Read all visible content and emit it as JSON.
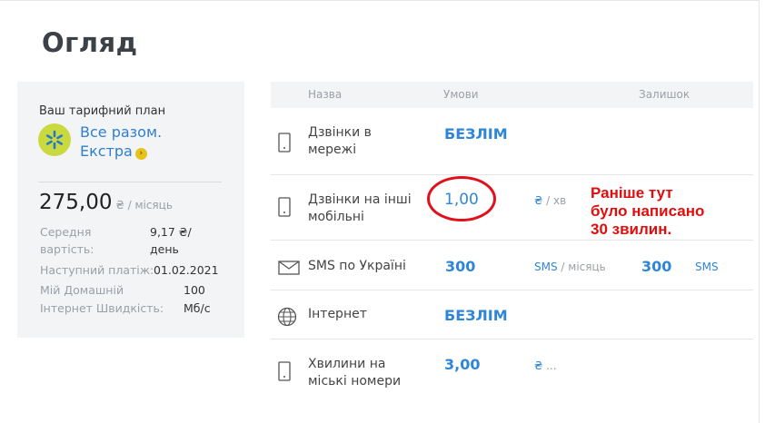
{
  "page": {
    "title": "Огляд"
  },
  "tariff": {
    "caption": "Ваш тарифний план",
    "name_line1": "Все разом.",
    "name_line2": "Екстра",
    "go_icon": "›",
    "price": "275,00",
    "price_unit": "₴ / місяць",
    "stats": [
      {
        "label1": "Середня",
        "label2": "вартість:",
        "value1": "9,17 ₴/",
        "value2": "день"
      },
      {
        "label": "Наступний платіж:",
        "value": "01.02.2021"
      },
      {
        "label": "Мій Домашній",
        "value": "100"
      },
      {
        "label": "Інтернет Швидкість:",
        "value": "Мб/с"
      }
    ],
    "logo_color": "#c9da3f"
  },
  "table": {
    "headers": {
      "name": "Назва",
      "terms": "Умови",
      "remaining": "Залишок"
    },
    "rows": [
      {
        "icon": "phone-icon",
        "name_line1": "Дзвінки в",
        "name_line2": "мережі",
        "value": "БЕЗЛІМ"
      },
      {
        "icon": "phone-icon",
        "name_line1": "Дзвінки на інші",
        "name_line2": "мобільні",
        "value": "1,00",
        "unit_main": "₴",
        "unit_sub": " / хв"
      },
      {
        "icon": "envelope-icon",
        "name": "SMS по Україні",
        "value": "300",
        "unit_main": "SMS",
        "unit_sub": " / місяць",
        "remaining": "300",
        "remaining_unit": "SMS"
      },
      {
        "icon": "globe-icon",
        "name": "Інтернет",
        "value": "БЕЗЛІМ"
      },
      {
        "icon": "phone-icon",
        "name_line1": "Хвилини на",
        "name_line2": "міські номери",
        "value": "3,00",
        "unit_main": "₴",
        "unit_sub": " ..."
      }
    ]
  },
  "annotation": {
    "line1": "Раніше тут",
    "line2": "було написано",
    "line3": "30 звилин.",
    "color": "#e10d0d"
  },
  "colors": {
    "accent": "#2f86d6",
    "card_bg": "#f3f4f6"
  }
}
